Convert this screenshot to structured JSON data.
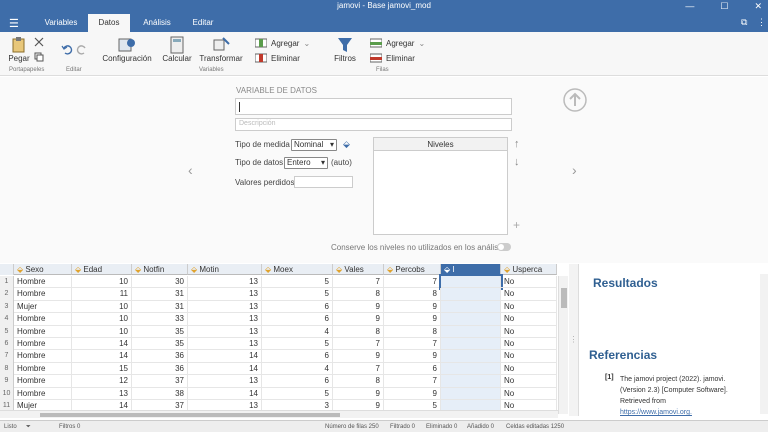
{
  "window": {
    "title": "jamovi - Base jamovi_mod",
    "minimize": "—",
    "maximize": "☐",
    "close": "✕"
  },
  "menu": {
    "tabs": [
      "Variables",
      "Datos",
      "Análisis",
      "Editar"
    ],
    "active": "Datos"
  },
  "ribbon": {
    "paste": "Pegar",
    "clipboard_group": "Portapapeles",
    "edit_group": "Editar",
    "setup": "Configuración",
    "compute": "Calcular",
    "transform": "Transformar",
    "variables_group": "Variables",
    "var_add": "Agregar",
    "var_delete": "Eliminar",
    "filters": "Filtros",
    "row_add": "Agregar",
    "row_delete": "Eliminar",
    "rows_group": "Filas"
  },
  "setup": {
    "header": "VARIABLE DE DATOS",
    "name_value": "",
    "description_placeholder": "Descripción",
    "measure_label": "Tipo de medida",
    "measure_value": "Nominal",
    "datatype_label": "Tipo de datos",
    "datatype_value": "Entero",
    "auto_label": "(auto)",
    "missing_label": "Valores perdidos",
    "levels_header": "Niveles",
    "retain_label": "Conserve los niveles no utilizados en los análisis"
  },
  "columns": [
    "Sexo",
    "Edad",
    "Notfin",
    "Motin",
    "Moex",
    "Vales",
    "Percobs",
    "I",
    "Usperca"
  ],
  "rows": [
    [
      "Hombre",
      "10",
      "30",
      "13",
      "5",
      "7",
      "7",
      "",
      "No"
    ],
    [
      "Hombre",
      "11",
      "31",
      "13",
      "5",
      "8",
      "8",
      "",
      "No"
    ],
    [
      "Mujer",
      "10",
      "31",
      "13",
      "6",
      "9",
      "9",
      "",
      "No"
    ],
    [
      "Hombre",
      "10",
      "33",
      "13",
      "6",
      "9",
      "9",
      "",
      "No"
    ],
    [
      "Hombre",
      "10",
      "35",
      "13",
      "4",
      "8",
      "8",
      "",
      "No"
    ],
    [
      "Hombre",
      "14",
      "35",
      "13",
      "5",
      "7",
      "7",
      "",
      "No"
    ],
    [
      "Hombre",
      "14",
      "36",
      "14",
      "6",
      "9",
      "9",
      "",
      "No"
    ],
    [
      "Hombre",
      "15",
      "36",
      "14",
      "4",
      "7",
      "6",
      "",
      "No"
    ],
    [
      "Hombre",
      "12",
      "37",
      "13",
      "6",
      "8",
      "7",
      "",
      "No"
    ],
    [
      "Hombre",
      "13",
      "38",
      "14",
      "5",
      "9",
      "9",
      "",
      "No"
    ],
    [
      "Mujer",
      "14",
      "37",
      "13",
      "3",
      "9",
      "5",
      "",
      "No"
    ]
  ],
  "row_numbers": [
    "1",
    "2",
    "3",
    "4",
    "5",
    "6",
    "7",
    "8",
    "9",
    "10",
    "11"
  ],
  "results": {
    "heading": "Resultados",
    "references_heading": "Referencias",
    "ref_num": "[1]",
    "ref_line1": "The jamovi project (2022). jamovi.",
    "ref_line2": "(Version 2.3) [Computer Software].",
    "ref_line3": "Retrieved from",
    "ref_link": "https://www.jamovi.org."
  },
  "status": {
    "ready": "Listo",
    "filters": "Filtros 0",
    "rows": "Número de filas 250",
    "filtered": "Filtrado 0",
    "deleted": "Eliminado 0",
    "added": "Añadido 0",
    "edited": "Celdas editadas 1250"
  },
  "colors": {
    "brand": "#3e6da9",
    "ribbon": "#f7f7f7"
  }
}
